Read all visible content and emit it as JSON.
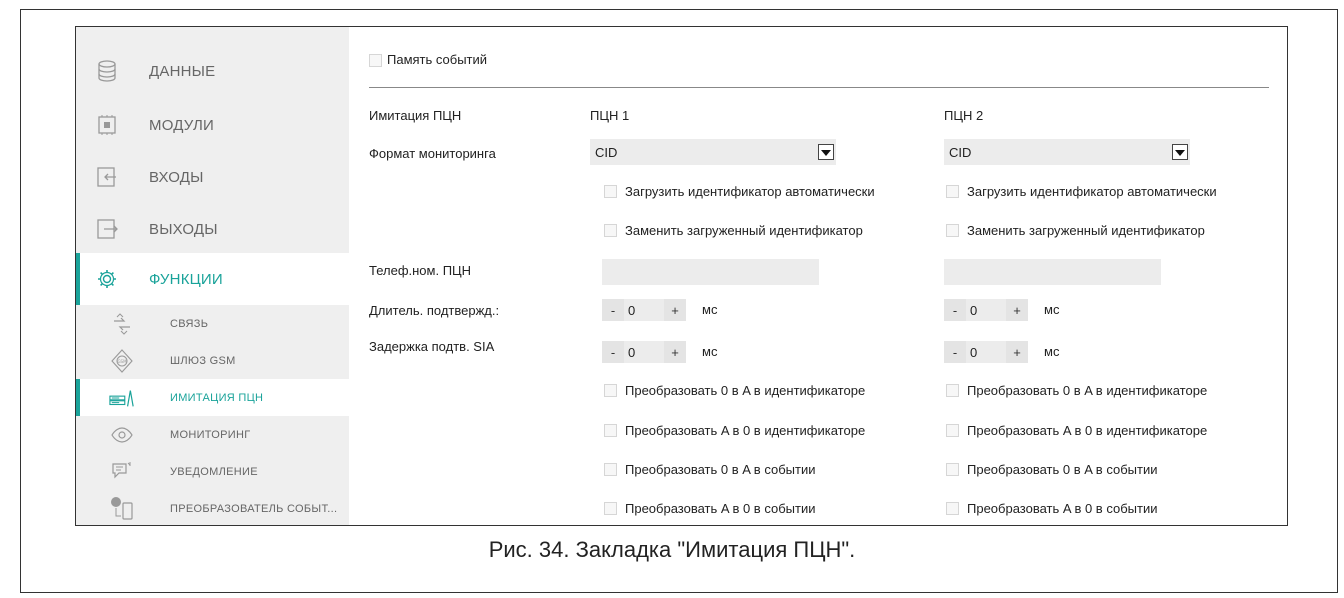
{
  "sidebar": {
    "items": [
      {
        "label": "ДАННЫЕ",
        "icon": "database-icon"
      },
      {
        "label": "МОДУЛИ",
        "icon": "module-icon"
      },
      {
        "label": "ВХОДЫ",
        "icon": "input-icon"
      },
      {
        "label": "ВЫХОДЫ",
        "icon": "output-icon"
      },
      {
        "label": "ФУНКЦИИ",
        "icon": "gear-icon",
        "active": true
      }
    ],
    "subitems": [
      {
        "label": "СВЯЗЬ",
        "icon": "connection-icon"
      },
      {
        "label": "ШЛЮЗ GSM",
        "icon": "gsm-gateway-icon"
      },
      {
        "label": "ИМИТАЦИЯ ПЦН",
        "icon": "monitoring-station-icon",
        "active": true
      },
      {
        "label": "МОНИТОРИНГ",
        "icon": "eye-icon"
      },
      {
        "label": "УВЕДОМЛЕНИЕ",
        "icon": "notification-icon"
      },
      {
        "label": "ПРЕОБРАЗОВАТЕЛЬ СОБЫТ...",
        "icon": "event-converter-icon"
      }
    ]
  },
  "main": {
    "event_memory_label": "Память событий",
    "station_emulation_label": "Имитация ПЦН",
    "station1_header": "ПЦН 1",
    "station2_header": "ПЦН 2",
    "monitoring_format_label": "Формат мониторинга",
    "phone_label": "Телеф.ном.  ПЦН",
    "ack_duration_label": "Длитель. подтвержд.:",
    "sia_delay_label": "Задержка подтв. SIA",
    "columns": [
      {
        "format": "CID",
        "load_id_auto": "Загрузить идентификатор автоматически",
        "replace_loaded_id": "Заменить загруженный идентификатор",
        "phone": "",
        "ack_duration": "0",
        "sia_delay": "0",
        "unit": "мс",
        "convert_0a_id": "Преобразовать 0 в A в идентификаторе",
        "convert_a0_id": "Преобразовать A в 0 в идентификаторе",
        "convert_0a_event": "Преобразовать 0 в A в событии",
        "convert_a0_event": "Преобразовать A в 0 в событии"
      },
      {
        "format": "CID",
        "load_id_auto": "Загрузить идентификатор автоматически",
        "replace_loaded_id": "Заменить загруженный идентификатор",
        "phone": "",
        "ack_duration": "0",
        "sia_delay": "0",
        "unit": "мс",
        "convert_0a_id": "Преобразовать 0 в A в идентификаторе",
        "convert_a0_id": "Преобразовать A в 0 в идентификаторе",
        "convert_0a_event": "Преобразовать 0 в A в событии",
        "convert_a0_event": "Преобразовать A в 0 в событии"
      }
    ],
    "stepper_minus": "-",
    "stepper_plus": "+"
  },
  "caption": "Рис. 34. Закладка \"Имитация ПЦН\".",
  "colors": {
    "accent": "#1aa39a",
    "sidebar_bg": "#efefef",
    "field_bg": "#ececec"
  }
}
